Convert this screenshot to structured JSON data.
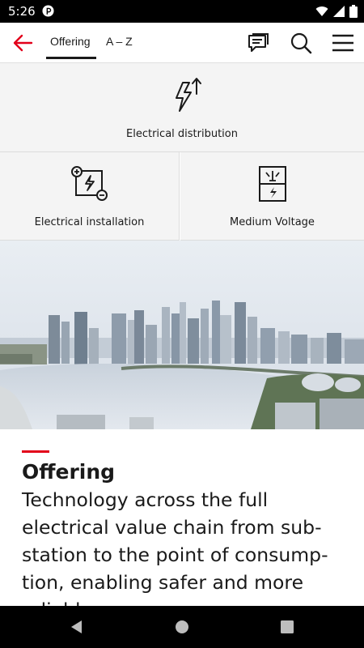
{
  "status_bar": {
    "time": "5:26",
    "icons": [
      "app-notification-icon",
      "wifi-icon",
      "signal-icon",
      "battery-icon"
    ]
  },
  "app_bar": {
    "back_icon": "arrow-left-icon",
    "tabs": [
      {
        "label": "Offering",
        "active": true
      },
      {
        "label": "A – Z",
        "active": false
      }
    ],
    "actions": [
      "chat-icon",
      "search-icon",
      "menu-icon"
    ],
    "accent_color": "#e2001a"
  },
  "tiles": [
    {
      "label": "Electrical distribution",
      "icon": "electrical-distribution-icon"
    },
    {
      "label": "Electrical installation",
      "icon": "electrical-installation-icon"
    },
    {
      "label": "Medium Voltage",
      "icon": "medium-voltage-icon"
    }
  ],
  "hero": {
    "icon": "city-skyline-photo"
  },
  "content": {
    "heading": "Offering",
    "body": "Technology across the full electrical value chain from sub-station to the point of consump-tion, enabling safer and more reliable power"
  },
  "nav_bar": {
    "buttons": [
      "back-triangle-icon",
      "home-circle-icon",
      "recents-square-icon"
    ]
  }
}
